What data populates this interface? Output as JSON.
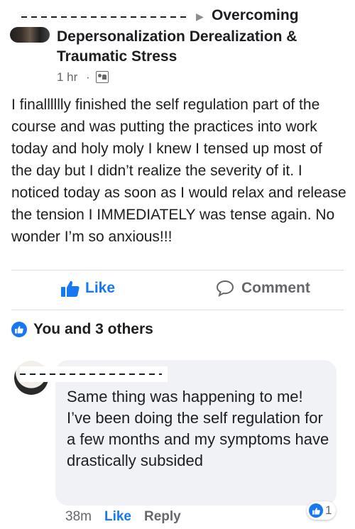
{
  "post": {
    "author_redacted": "- - - - - - - - - - - - - - - -",
    "group_name_line1": "Overcoming",
    "group_name_line2": "Depersonalization Derealization &",
    "group_name_line3": "Traumatic Stress",
    "timestamp": "1 hr",
    "separator": "·",
    "audience_icon": "group-audience-icon",
    "body": "I finalllllly finished the self regulation part of the course and was putting the practices into work today and holy moly I knew I tensed up most of the day but I didn’t realize the severity of it. I noticed today as soon as I would relax and release the tension I IMMEDIATELY was tense again. No wonder I’m so anxious!!!"
  },
  "actions": {
    "like_label": "Like",
    "comment_label": "Comment"
  },
  "reactions": {
    "summary": "You and 3 others"
  },
  "comment": {
    "text": "Same thing was happening to me! I’ve been doing the self regulation for a few months and my symptoms have drastically subsided",
    "time": "38m",
    "like_label": "Like",
    "reply_label": "Reply",
    "like_count": "1"
  },
  "colors": {
    "accent": "#1877f2",
    "secondary_text": "#65676b",
    "bubble": "#f0f2f5"
  }
}
